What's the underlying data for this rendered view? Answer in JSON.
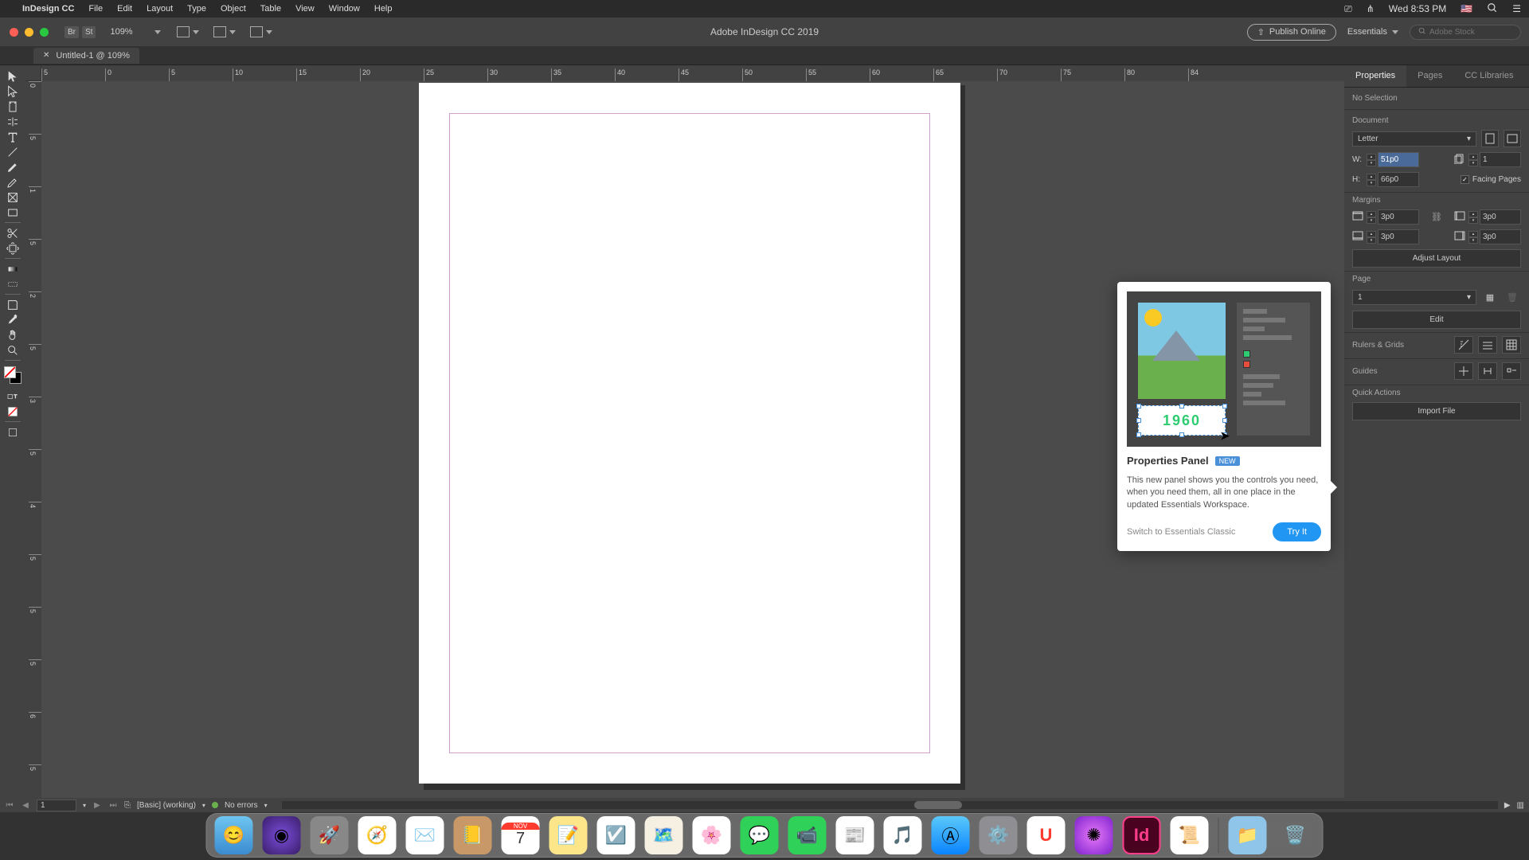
{
  "menubar": {
    "app_name": "InDesign CC",
    "menus": [
      "File",
      "Edit",
      "Layout",
      "Type",
      "Object",
      "Table",
      "View",
      "Window",
      "Help"
    ],
    "clock": "Wed 8:53 PM"
  },
  "appbar": {
    "title": "Adobe InDesign CC 2019",
    "zoom": "109%",
    "publish": "Publish Online",
    "workspace": "Essentials",
    "stock_placeholder": "Adobe Stock"
  },
  "tab": {
    "label": "Untitled-1 @ 109%"
  },
  "ruler_h": [
    "5",
    "0",
    "5",
    "10",
    "15",
    "20",
    "25",
    "30",
    "35",
    "40",
    "45",
    "50",
    "55",
    "60",
    "65",
    "70",
    "75",
    "80",
    "84"
  ],
  "ruler_v": [
    "0",
    "5",
    "1",
    "5",
    "2",
    "5",
    "3",
    "5",
    "4",
    "5",
    "5",
    "5",
    "6",
    "5"
  ],
  "right_panel": {
    "tabs": [
      "Properties",
      "Pages",
      "CC Libraries"
    ],
    "no_selection": "No Selection",
    "section_document": "Document",
    "preset": "Letter",
    "w_label": "W:",
    "w_value": "51p0",
    "h_label": "H:",
    "h_value": "66p0",
    "facing_pages": "Facing Pages",
    "section_margins": "Margins",
    "margin_top": "3p0",
    "margin_bottom": "3p0",
    "margin_left": "3p0",
    "margin_right": "3p0",
    "adjust_layout": "Adjust Layout",
    "section_page": "Page",
    "page_value": "1",
    "edit_btn": "Edit",
    "rulers_grids": "Rulers & Grids",
    "guides": "Guides",
    "quick_actions": "Quick Actions",
    "import_file": "Import File"
  },
  "popup": {
    "title": "Properties Panel",
    "new_badge": "NEW",
    "year": "1960",
    "description": "This new panel shows you the controls you need, when you need them, all in one place in the updated Essentials Workspace.",
    "switch_link": "Switch to Essentials Classic",
    "try_it": "Try It"
  },
  "statusbar": {
    "page": "1",
    "style": "[Basic] (working)",
    "errors": "No errors"
  },
  "dock": {
    "apps": [
      "Finder",
      "Siri",
      "Launchpad",
      "Safari",
      "Mail",
      "Contacts",
      "Calendar",
      "Notes",
      "Reminders",
      "Maps",
      "Photos",
      "Messages",
      "FaceTime",
      "News",
      "Music",
      "AppStore",
      "Settings",
      "Magnet",
      "Flower",
      "InDesign",
      "Script",
      "Downloads",
      "Trash"
    ],
    "cal_month": "NOV",
    "cal_day": "7"
  }
}
